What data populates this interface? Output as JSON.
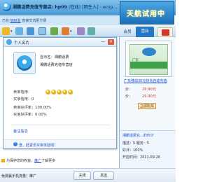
{
  "titlebar": {
    "title": "湘鹏话费充值专营店:",
    "contact": "hp09",
    "status": "(在线)",
    "stranger": "[陌生人]",
    "extra": "- ecsp..."
  },
  "banner": {
    "text": "天航试用中"
  },
  "status_row": {
    "prefix": "已在",
    "link": "加好友",
    "suffix": "直接交流更方便"
  },
  "right_tabs": {
    "member": "会员",
    "shop": "营店"
  },
  "card": {
    "title": "个人名片",
    "minimize": "—",
    "close": "×",
    "display_name_label": "显示名：",
    "display_name": "湘鹏话费",
    "shop_name": "湘鹏话费充值专营店",
    "seller_credit_label": "卖家信用：",
    "buyer_credit_label": "买家信用：",
    "buyer_credit_value": "0",
    "seller_good_rate_label": "卖家好评率：",
    "seller_good_rate_value": "100.00%",
    "buyer_good_rate_label": "买家好评率：",
    "buyer_good_rate_value": "0.00%",
    "remark_label": "备注信息",
    "help": "?",
    "footer_link": "查，赶紧去买家体验吧！"
  },
  "warning": {
    "prefix": "为保护您的权益，",
    "link": "推广",
    "suffix": "了解更多"
  },
  "bottom": {
    "free_text": "免费赢手机流量！推广",
    "close_btn": "关闭",
    "send_btn": "发送"
  },
  "right_panel": {
    "product_region": "广东",
    "product_title": "广东移动30元快充自动充值",
    "price_label": "价：",
    "price_value": "29.90元",
    "price2_label": "价：",
    "price2_value": "29.90元",
    "buy_btn": "立即购买",
    "shop_name": "湘鹏话费充...的伙计",
    "shop_credit": "描述：5  服务：5",
    "shop_stats": "好评：100%",
    "shop_open_label": "开店时间：",
    "shop_open_date": "2011-09-26"
  },
  "colors": {
    "accent": "#2677c2",
    "price": "#d23c1d",
    "link": "#1a4fd0"
  }
}
